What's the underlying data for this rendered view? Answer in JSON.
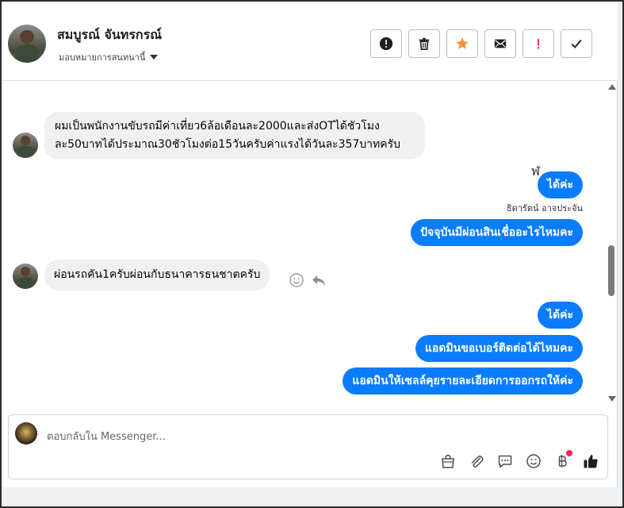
{
  "header": {
    "contact_name": "สมบูรณ์ จันทรกรณ์",
    "assign_label": "มอบหมายการสนทนานี้",
    "actions": [
      {
        "name": "spam-button",
        "icon": "alert-circle-icon"
      },
      {
        "name": "delete-button",
        "icon": "trash-icon"
      },
      {
        "name": "star-button",
        "icon": "star-icon",
        "color": "#f7923a"
      },
      {
        "name": "mark-unread-button",
        "icon": "envelope-icon"
      },
      {
        "name": "follow-up-button",
        "icon": "exclamation-icon",
        "color": "#e41e3f"
      },
      {
        "name": "done-button",
        "icon": "check-icon"
      }
    ]
  },
  "thread": {
    "top_glyph": "ฬ",
    "messages": [
      {
        "direction": "in",
        "lines": [
          "ผมเป็นพนักงานขับรถมีค่าเที่ยว6ล้อเดือนละ2000และส่งOTได้ชัวโมง",
          "ละ50บาทได้ประมาณ30ชัวโมงต่อ15วันครับค่าแรงได้วันละ357บาทครับ"
        ]
      },
      {
        "direction": "out",
        "text": "ได้ค่ะ"
      },
      {
        "direction": "out",
        "sender": "ธิดารัตน์ อาจประจัน",
        "text": "ปัจจุบันมีผ่อนสินเชื่ออะไรไหมคะ"
      },
      {
        "direction": "in",
        "text": "ผ่อนรถคัน1ครับผ่อนกับธนาคารธนชาตครับ"
      },
      {
        "direction": "out",
        "text": "ได้ค่ะ"
      },
      {
        "direction": "out",
        "text": "แอดมินขอเบอร์ติดต่อได้ไหมคะ"
      },
      {
        "direction": "out",
        "text": "แอดมินให้เซลล์คุยรายละเอียดการออกรถให้ค่ะ"
      }
    ]
  },
  "composer": {
    "placeholder": "ตอบกลับใน Messenger...",
    "tools": [
      "shopping-bag-icon",
      "paperclip-icon",
      "saved-reply-icon",
      "emoji-icon",
      "baht-payment-icon",
      "thumbs-up-icon"
    ]
  },
  "colors": {
    "outgoing_bubble": "#0a7cff",
    "incoming_bubble": "#f0f0f0",
    "notification_dot": "#f02849"
  }
}
